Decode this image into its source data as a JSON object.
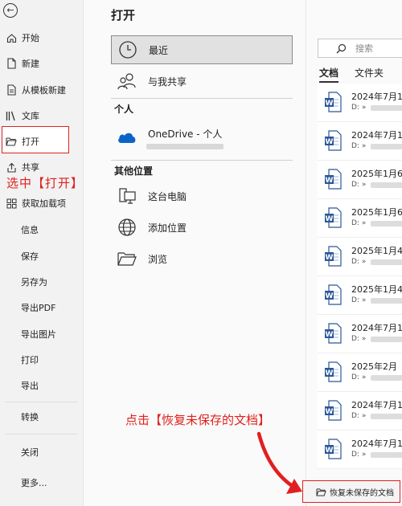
{
  "sidebar": {
    "items": [
      {
        "label": "开始",
        "icon": "home-icon"
      },
      {
        "label": "新建",
        "icon": "new-document-icon"
      },
      {
        "label": "从模板新建",
        "icon": "template-icon"
      },
      {
        "label": "文库",
        "icon": "library-icon"
      },
      {
        "label": "打开",
        "icon": "folder-open-icon"
      },
      {
        "label": "共享",
        "icon": "share-icon"
      },
      {
        "label": "获取加载项",
        "icon": "addins-icon"
      }
    ],
    "plain_items": [
      "信息",
      "保存",
      "另存为",
      "导出PDF",
      "导出图片",
      "打印",
      "导出",
      "转换",
      "关闭",
      "更多..."
    ]
  },
  "annotations": {
    "select_open": "选中【打开】",
    "click_recover": "点击【恢复未保存的文档】"
  },
  "main": {
    "title": "打开",
    "locations": [
      {
        "label": "最近",
        "icon": "clock-icon"
      },
      {
        "label": "与我共享",
        "icon": "people-icon"
      }
    ],
    "personal_label": "个人",
    "onedrive_label": "OneDrive - 个人",
    "other_label": "其他位置",
    "other_locations": [
      {
        "label": "这台电脑",
        "icon": "computer-icon"
      },
      {
        "label": "添加位置",
        "icon": "globe-icon"
      },
      {
        "label": "浏览",
        "icon": "folder-icon"
      }
    ]
  },
  "right": {
    "search_placeholder": "搜索",
    "tabs": [
      "文档",
      "文件夹"
    ],
    "docs": [
      {
        "date": "2024年7月1",
        "path": "D: »"
      },
      {
        "date": "2024年7月1",
        "path": "D: »"
      },
      {
        "date": "2025年1月6",
        "path": "D: »"
      },
      {
        "date": "2025年1月6",
        "path": "D: »"
      },
      {
        "date": "2025年1月4",
        "path": "D: »"
      },
      {
        "date": "2025年1月4",
        "path": "D: »"
      },
      {
        "date": "2024年7月1",
        "path": "D: »"
      },
      {
        "date": "2025年2月",
        "path": "D: »"
      },
      {
        "date": "2024年7月1",
        "path": "D: »"
      },
      {
        "date": "2024年7月1",
        "path": "D: »"
      }
    ],
    "recover_label": "恢复未保存的文档"
  },
  "colors": {
    "highlight_red": "#e02020",
    "word_blue": "#2b5797",
    "onedrive_blue": "#0a64c8"
  }
}
